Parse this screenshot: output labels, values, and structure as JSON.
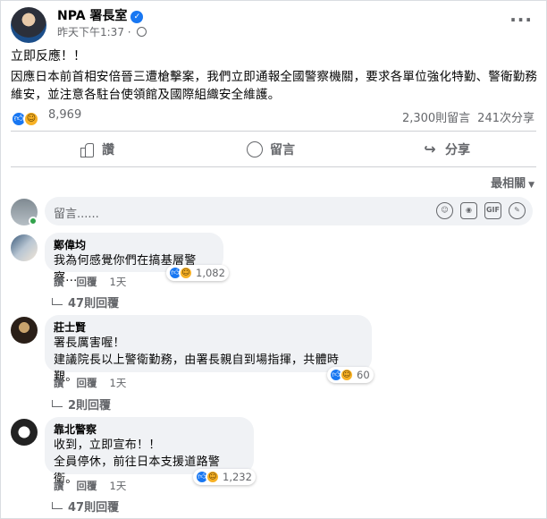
{
  "post": {
    "page_name": "NPA 署長室",
    "timestamp": "昨天下午1:37",
    "line1": "立即反應！！",
    "body": "因應日本前首相安倍晉三遭槍擊案，我們立即通報全國警察機關，要求各單位強化特勤、警衛勤務維安，並注意各駐台使領館及國際組織安全維護。",
    "reaction_count": "8,969",
    "comment_count": "2,300則留言",
    "share_count": "241次分享",
    "colors": {
      "brand_blue": "#1877f2",
      "haha_yellow": "#f7b125",
      "online_green": "#31a24c"
    }
  },
  "actions": {
    "like": "讚",
    "comment": "留言",
    "share": "分享"
  },
  "sort_label": "最相關",
  "comment_input": {
    "placeholder": "留言......"
  },
  "comments": [
    {
      "author": "鄭偉均",
      "lines": [
        "我為何感覺你們在搞基層警察..."
      ],
      "reactions": "1,082",
      "like": "讚",
      "reply": "回覆",
      "time": "1天",
      "replies": "47則回覆"
    },
    {
      "author": "莊士賢",
      "lines": [
        "署長厲害喔！",
        "建議院長以上警衛勤務，由署長親自到場指揮，共體時艱。"
      ],
      "reactions": "60",
      "like": "讚",
      "reply": "回覆",
      "time": "1天",
      "replies": "2則回覆"
    },
    {
      "author": "靠北警察",
      "lines": [
        "收到，立即宣布！！",
        "全員停休，前往日本支援道路警衛。"
      ],
      "reactions": "1,232",
      "like": "讚",
      "reply": "回覆",
      "time": "1天",
      "replies": "47則回覆"
    }
  ]
}
